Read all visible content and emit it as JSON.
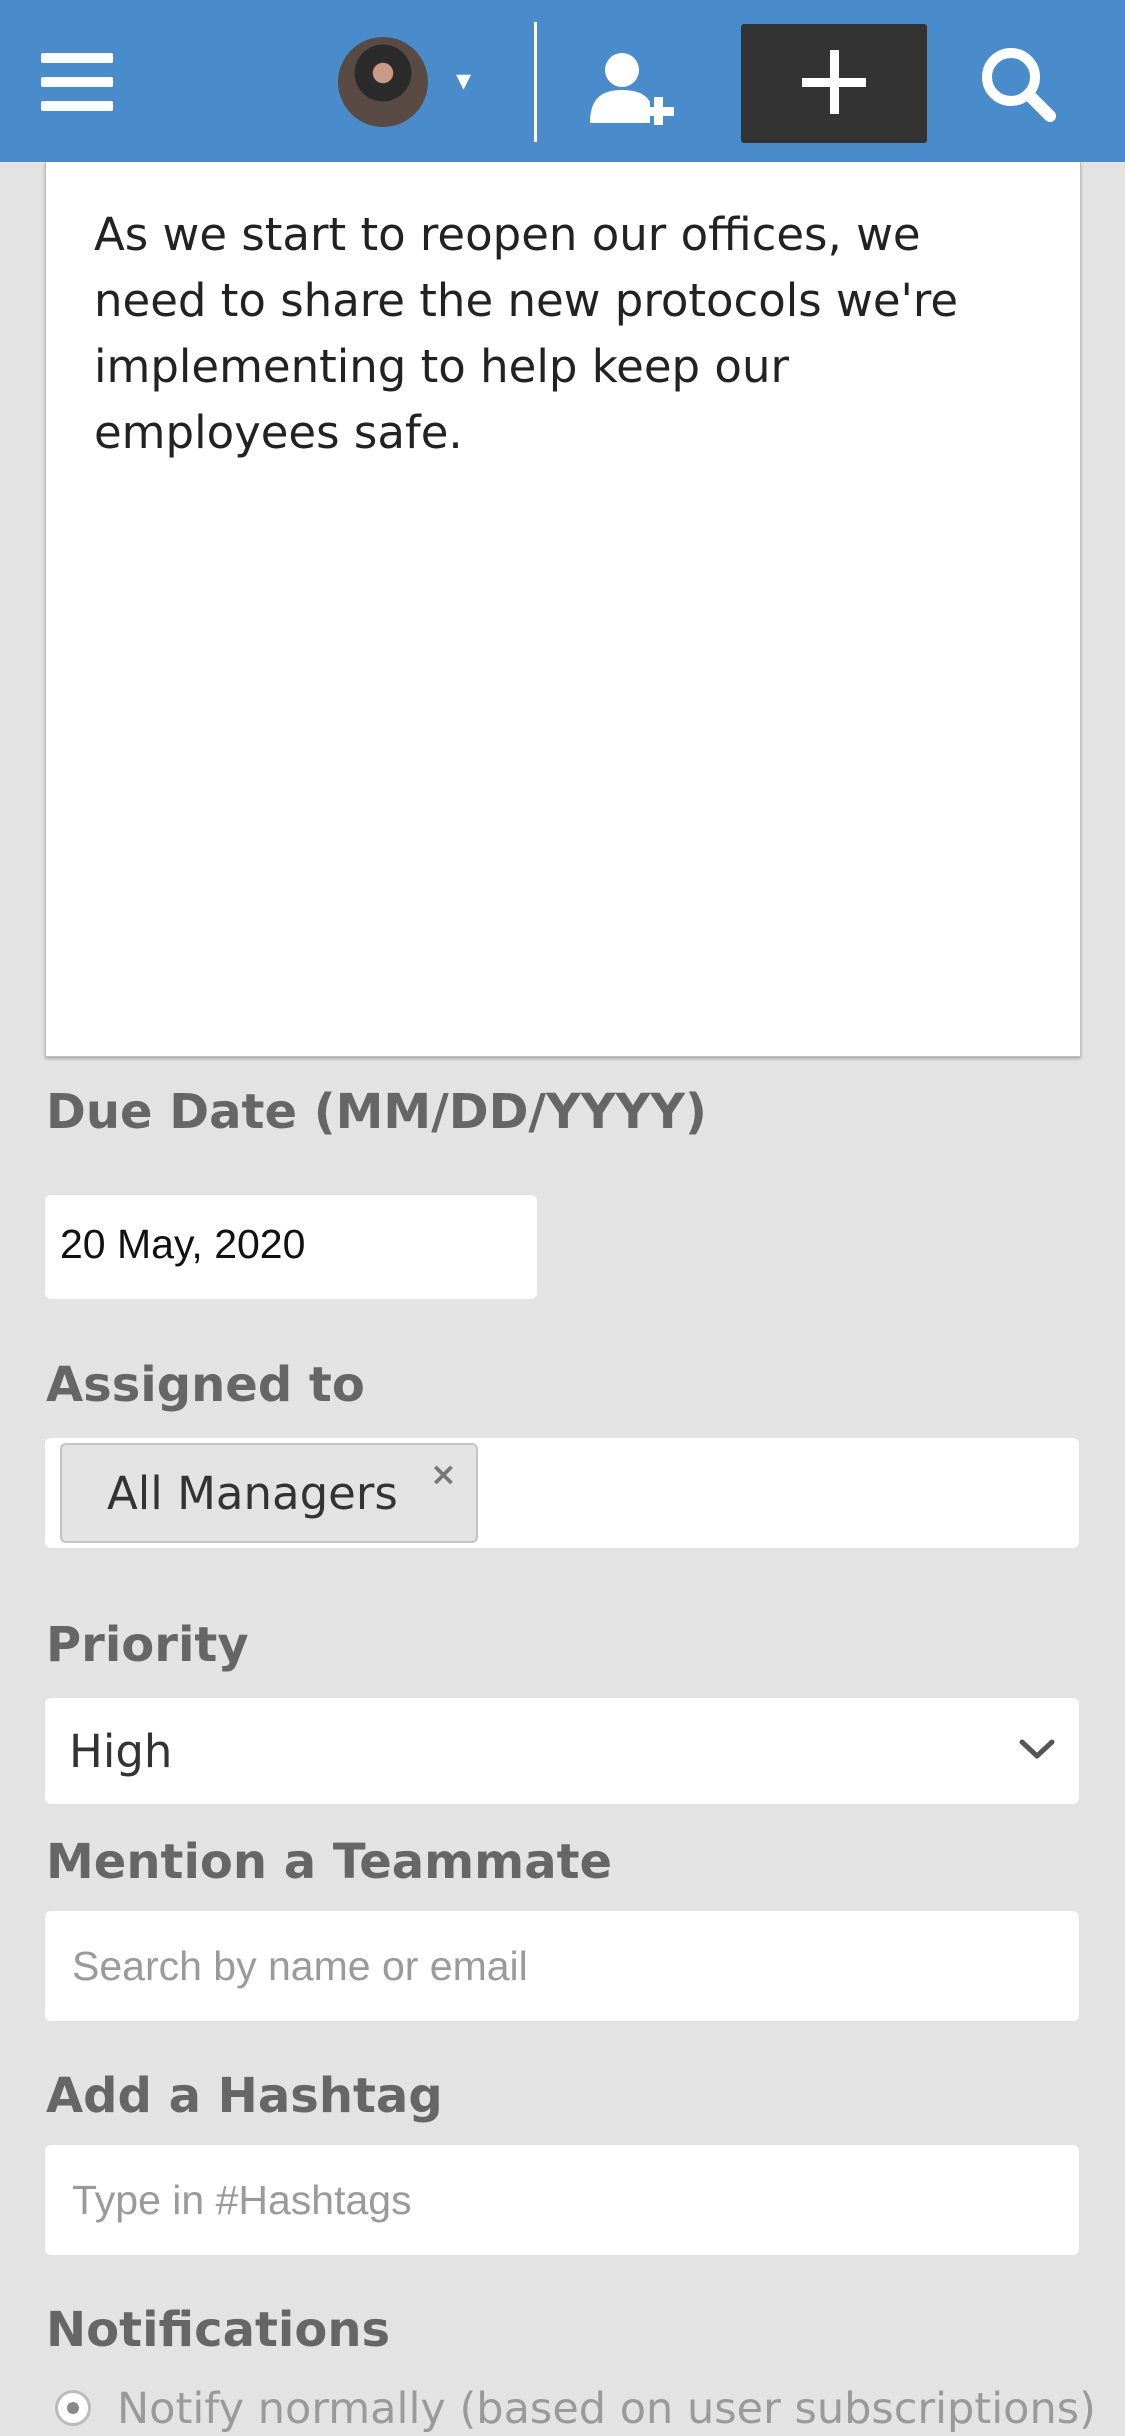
{
  "header": {
    "menu_icon": "hamburger-menu-icon",
    "avatar_caret": "▾",
    "add_user_icon": "add-user-icon",
    "search_icon": "search-icon",
    "accent_color": "#4a8ccb",
    "add_button_color": "#333333"
  },
  "description": {
    "text": "As we start to reopen our offices, we need to share the new protocols we're implementing to help keep our employees safe."
  },
  "due_date": {
    "label": "Due Date (MM/DD/YYYY)",
    "value": "20 May, 2020"
  },
  "assigned_to": {
    "label": "Assigned to",
    "chips": [
      "All Managers"
    ],
    "remove_glyph": "×"
  },
  "priority": {
    "label": "Priority",
    "selected": "High"
  },
  "mention": {
    "label": "Mention a Teammate",
    "placeholder": "Search by name or email"
  },
  "hashtag": {
    "label": "Add a Hashtag",
    "placeholder": "Type in #Hashtags"
  },
  "notifications": {
    "label": "Notifications",
    "options": [
      {
        "label": "Notify normally (based on user subscriptions)",
        "selected": true
      }
    ]
  }
}
